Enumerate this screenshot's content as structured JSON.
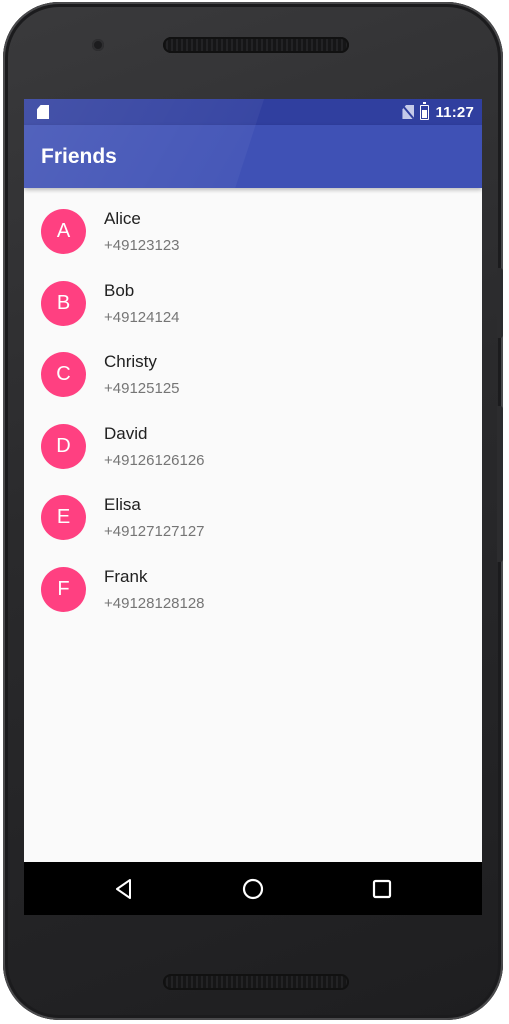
{
  "status_bar": {
    "time": "11:27"
  },
  "app_bar": {
    "title": "Friends"
  },
  "contacts": [
    {
      "initial": "A",
      "name": "Alice",
      "phone": "+49123123"
    },
    {
      "initial": "B",
      "name": "Bob",
      "phone": "+49124124"
    },
    {
      "initial": "C",
      "name": "Christy",
      "phone": "+49125125"
    },
    {
      "initial": "D",
      "name": "David",
      "phone": "+49126126126"
    },
    {
      "initial": "E",
      "name": "Elisa",
      "phone": "+49127127127"
    },
    {
      "initial": "F",
      "name": "Frank",
      "phone": "+49128128128"
    }
  ],
  "nav_bar": {
    "icons": [
      "back-icon",
      "home-icon",
      "recents-icon"
    ]
  },
  "colors": {
    "primary": "#3f51b5",
    "primary_dark": "#303f9f",
    "accent": "#ff4081"
  }
}
